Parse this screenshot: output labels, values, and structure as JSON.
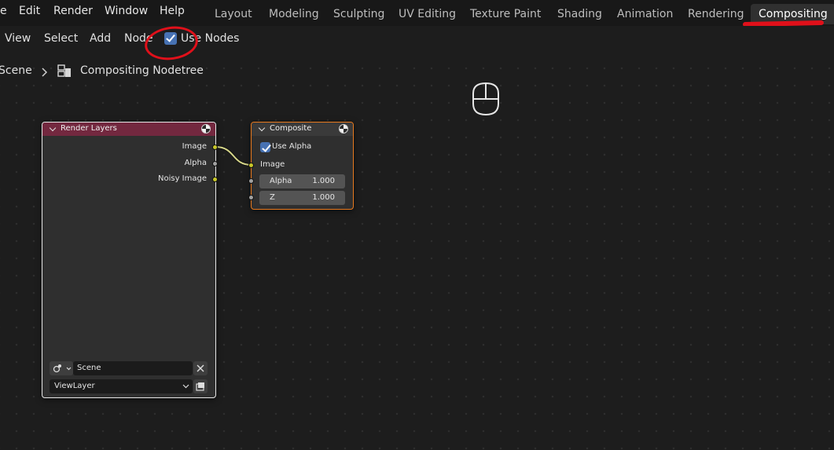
{
  "menu": {
    "items": [
      "e",
      "Edit",
      "Render",
      "Window",
      "Help"
    ]
  },
  "workspaces": {
    "tabs": [
      "Layout",
      "Modeling",
      "Sculpting",
      "UV Editing",
      "Texture Paint",
      "Shading",
      "Animation",
      "Rendering",
      "Compositing"
    ],
    "active": "Compositing"
  },
  "editor_header": {
    "view": "View",
    "select": "Select",
    "add": "Add",
    "node": "Node",
    "use_nodes_label": "Use Nodes",
    "use_nodes_checked": true
  },
  "breadcrumb": {
    "scene": "Scene",
    "nodetree": "Compositing Nodetree"
  },
  "nodes": {
    "render_layers": {
      "title": "Render Layers",
      "header_color": "#73283f",
      "outputs": [
        "Image",
        "Alpha",
        "Noisy Image"
      ],
      "scene": "Scene",
      "view_layer": "ViewLayer"
    },
    "composite": {
      "title": "Composite",
      "header_color": "#3a3a3a",
      "use_alpha_label": "Use Alpha",
      "use_alpha_checked": true,
      "input_image": "Image",
      "alpha_label": "Alpha",
      "alpha_value": "1.000",
      "z_label": "Z",
      "z_value": "1.000"
    }
  },
  "colors": {
    "annotation_red": "#e0101a",
    "socket_color": "#c7c729",
    "checkbox_blue": "#4772b3",
    "selected_border": "#e8791e"
  }
}
